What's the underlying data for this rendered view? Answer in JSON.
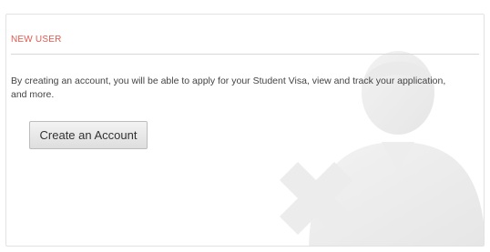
{
  "panel": {
    "title": "NEW USER",
    "description": "By creating an account, you will be able to apply for your Student Visa, view and track your application, and more.",
    "button_label": "Create an Account",
    "accent_color": "#e05a4f",
    "watermark_icon": "user-add-icon"
  }
}
